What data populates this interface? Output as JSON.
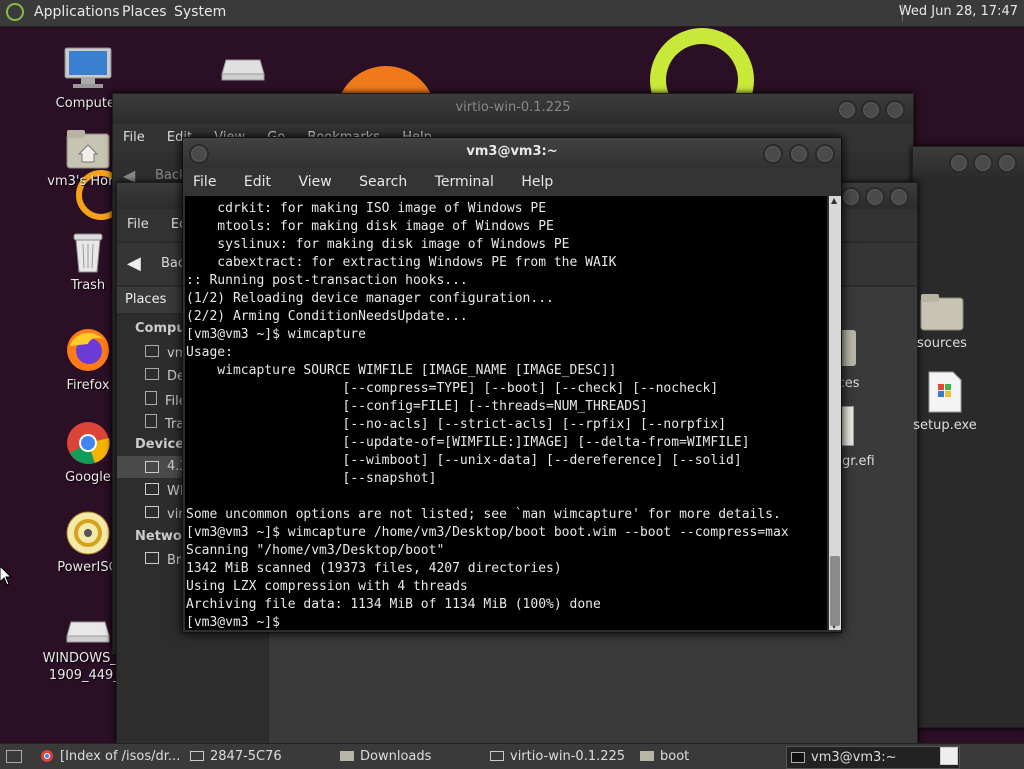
{
  "top_panel": {
    "menus": [
      "Applications",
      "Places",
      "System"
    ],
    "clock": "Wed Jun 28, 17:47"
  },
  "desktop_icons": [
    {
      "label": "Computer",
      "icon": "computer-icon"
    },
    {
      "label": "vm3's Home",
      "icon": "home-folder-icon"
    },
    {
      "label": "Trash",
      "icon": "trash-icon"
    },
    {
      "label": "Firefox",
      "icon": "firefox-icon"
    },
    {
      "label": "Google",
      "icon": "chrome-icon"
    },
    {
      "label": "PowerISO",
      "icon": "poweriso-icon"
    },
    {
      "label": "WINDOWS_10 1909_449_L",
      "icon": "drive-icon"
    }
  ],
  "file_manager_back": {
    "title": "virtio-win-0.1.225",
    "menu": [
      "File",
      "Edit",
      "View",
      "Go",
      "Bookmarks",
      "Help"
    ],
    "back_label": "Back"
  },
  "file_manager_front": {
    "menu": [
      "File",
      "Edit"
    ],
    "back_label": "Back",
    "places_label": "Places",
    "sidebar": {
      "computer_heading": "Computer",
      "computer_items": [
        "vm3",
        "Desktop",
        "File System",
        "Trash"
      ],
      "devices_heading": "Devices",
      "device_items": [
        "4.3",
        "WINDOWS",
        "virtio"
      ],
      "network_heading": "Network",
      "network_items": [
        "Browse"
      ]
    }
  },
  "right_files": [
    {
      "label": "sources",
      "icon": "folder-icon"
    },
    {
      "label": "setup.exe",
      "icon": "exe-icon"
    }
  ],
  "partial_files": [
    "ices",
    "gr.efi"
  ],
  "terminal": {
    "title": "vm3@vm3:~",
    "menu": [
      "File",
      "Edit",
      "View",
      "Search",
      "Terminal",
      "Help"
    ],
    "lines": [
      "    cdrkit: for making ISO image of Windows PE",
      "    mtools: for making disk image of Windows PE",
      "    syslinux: for making disk image of Windows PE",
      "    cabextract: for extracting Windows PE from the WAIK",
      ":: Running post-transaction hooks...",
      "(1/2) Reloading device manager configuration...",
      "(2/2) Arming ConditionNeedsUpdate...",
      "[vm3@vm3 ~]$ wimcapture",
      "Usage:",
      "    wimcapture SOURCE WIMFILE [IMAGE_NAME [IMAGE_DESC]]",
      "                    [--compress=TYPE] [--boot] [--check] [--nocheck]",
      "                    [--config=FILE] [--threads=NUM_THREADS]",
      "                    [--no-acls] [--strict-acls] [--rpfix] [--norpfix]",
      "                    [--update-of=[WIMFILE:]IMAGE] [--delta-from=WIMFILE]",
      "                    [--wimboot] [--unix-data] [--dereference] [--solid]",
      "                    [--snapshot]",
      "",
      "Some uncommon options are not listed; see `man wimcapture' for more details.",
      "[vm3@vm3 ~]$ wimcapture /home/vm3/Desktop/boot boot.wim --boot --compress=max",
      "Scanning \"/home/vm3/Desktop/boot\"",
      "1342 MiB scanned (19373 files, 4207 directories)",
      "Using LZX compression with 4 threads",
      "Archiving file data: 1134 MiB of 1134 MiB (100%) done",
      "[vm3@vm3 ~]$ "
    ]
  },
  "taskbar": {
    "tasks": [
      {
        "label": "[Index of /isos/dr...",
        "icon": "chrome-icon"
      },
      {
        "label": "2847-5C76",
        "icon": "drive-icon"
      },
      {
        "label": "Downloads",
        "icon": "folder-icon"
      },
      {
        "label": "virtio-win-0.1.225",
        "icon": "drive-icon"
      },
      {
        "label": "boot",
        "icon": "folder-icon"
      },
      {
        "label": "vm3@vm3:~",
        "icon": "terminal-icon"
      }
    ]
  }
}
